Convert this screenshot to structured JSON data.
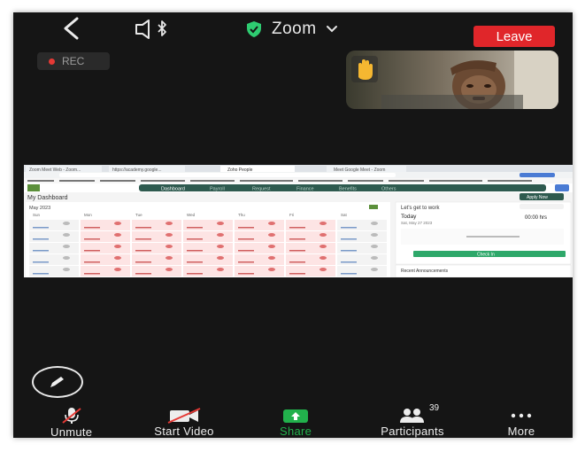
{
  "top_bar": {
    "title": "Zoom",
    "leave_label": "Leave"
  },
  "recording": {
    "label": "REC"
  },
  "toolbar": {
    "unmute_label": "Unmute",
    "start_video_label": "Start Video",
    "share_label": "Share",
    "participants_label": "Participants",
    "participants_count": "39",
    "more_label": "More"
  },
  "shared_screen": {
    "browser_tabs": [
      "Zoom Meet Web - Zoom...",
      "https://academy.google...",
      "Zoho People",
      "Meet Google Meet - Zoom"
    ],
    "nav_tabs": [
      "Dashboard",
      "Payroll",
      "Request",
      "Finance",
      "Benefits",
      "Others"
    ],
    "page_title": "My Dashboard",
    "month_label": "May 2023",
    "day_headers": [
      "Sun",
      "Mon",
      "Tue",
      "Wed",
      "Thu",
      "Fri",
      "Sat"
    ],
    "panel_title": "Let's get to work",
    "today_label": "Today",
    "today_date": "Sat, May 27 2023",
    "time_value": "00:00 hrs",
    "check_in_label": "Check In",
    "announcements_label": "Recent Announcements",
    "apply_leave_label": "Apply Now"
  },
  "colors": {
    "background": "#151515",
    "leave_red": "#e0262a",
    "share_green": "#22b14c",
    "shield_green": "#2ecc71",
    "rec_red": "#e53935"
  },
  "icons": [
    "back-chevron-icon",
    "speaker-bluetooth-icon",
    "shield-check-icon",
    "chevron-down-icon",
    "pen-icon",
    "mic-muted-icon",
    "video-off-icon",
    "share-arrow-icon",
    "participants-icon",
    "more-dots-icon",
    "raised-hand-icon"
  ]
}
